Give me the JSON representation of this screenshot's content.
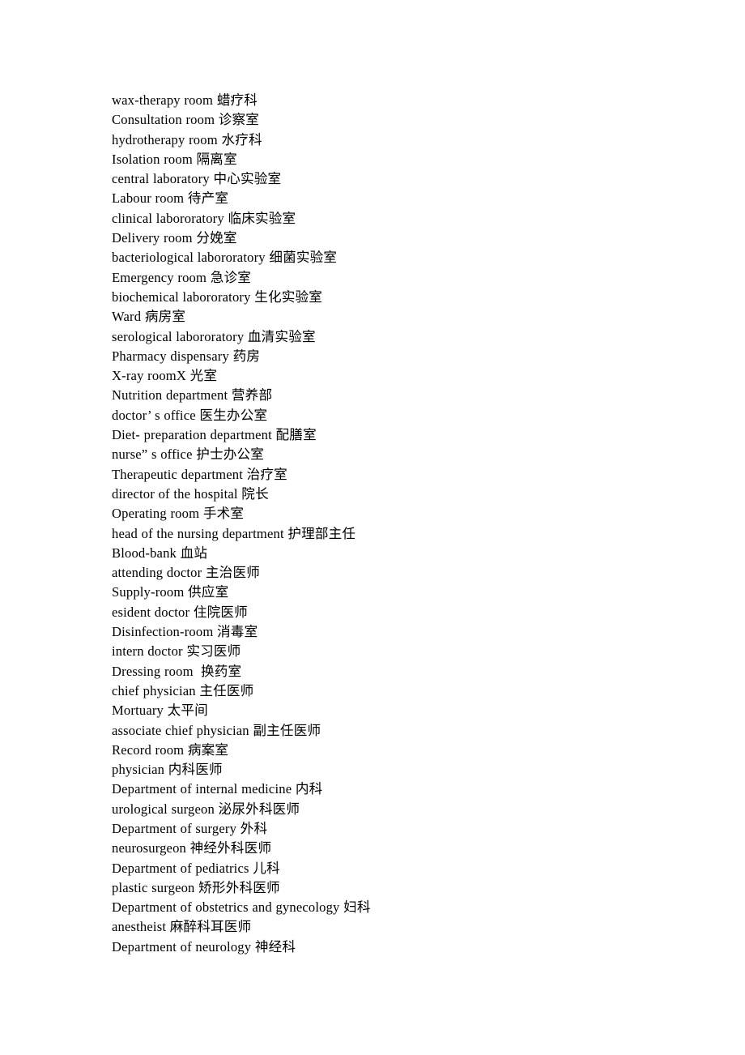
{
  "document": {
    "page_background": "#ffffff",
    "text_color": "#000000",
    "entries": [
      "wax-therapy room 蜡疗科",
      "Consultation room 诊察室",
      "hydrotherapy room 水疗科",
      "Isolation room 隔离室",
      "central laboratory 中心实验室",
      "Labour room 待产室",
      "clinical labororatory 临床实验室",
      "Delivery room 分娩室",
      "bacteriological labororatory 细菌实验室",
      "Emergency room 急诊室",
      "biochemical labororatory 生化实验室",
      "Ward 病房室",
      "serological labororatory 血清实验室",
      "Pharmacy dispensary 药房",
      "X-ray roomX 光室",
      "Nutrition department 营养部",
      "doctor’ s office 医生办公室",
      "Diet- preparation department 配膳室",
      "nurse” s office 护士办公室",
      "Therapeutic department 治疗室",
      "director of the hospital 院长",
      "Operating room 手术室",
      "head of the nursing department 护理部主任",
      "Blood-bank 血站",
      "attending doctor 主治医师",
      "Supply-room 供应室",
      "esident doctor 住院医师",
      "Disinfection-room 消毒室",
      "intern doctor 实习医师",
      "Dressing room  换药室",
      "chief physician 主任医师",
      "Mortuary 太平间",
      "associate chief physician 副主任医师",
      "Record room 病案室",
      "physician 内科医师",
      "Department of internal medicine 内科",
      "urological surgeon 泌尿外科医师",
      "Department of surgery 外科",
      "neurosurgeon 神经外科医师",
      "Department of pediatrics 儿科",
      "plastic surgeon 矫形外科医师",
      "Department of obstetrics and gynecology 妇科",
      "anestheist 麻醉科耳医师",
      "Department of neurology 神经科"
    ]
  }
}
